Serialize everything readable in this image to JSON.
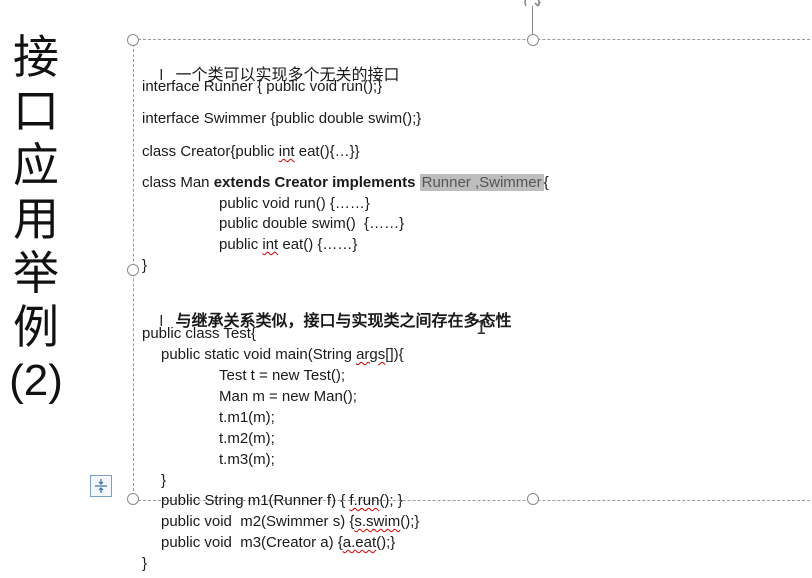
{
  "slide_title_chars": [
    "接",
    "口",
    "应",
    "用",
    "举",
    "例",
    "(2)"
  ],
  "bullet1": "一个类可以实现多个无关的接口",
  "bullet2": "与继承关系类似，接口与实现类之间存在多态性",
  "bullet_marker": "l",
  "code1": {
    "l1": "interface Runner { public void run();}",
    "l2": "interface Swimmer {public double swim();}",
    "l3_a": "class Creator{public ",
    "l3_b": "int",
    "l3_c": " eat(){…}}",
    "l4_a": "class Man ",
    "l4_b": "extends Creator implements",
    "l4_c": " ",
    "l4_sel": "Runner ,Swimmer",
    "l4_d": "{",
    "l5": "public void run() {……}",
    "l6": "public double swim()  {……}",
    "l7_a": "public ",
    "l7_b": "int",
    "l7_c": " eat() {……}",
    "l8": "}"
  },
  "code2": {
    "l1": "public class Test{",
    "l2_a": "public static void main(String ",
    "l2_b": "args",
    "l2_c": "[]){",
    "l3": "Test t = new Test();",
    "l4": "Man m = new Man();",
    "l5": "t.m1(m);",
    "l6": "t.m2(m);",
    "l7": "t.m3(m);",
    "l8": "}",
    "l9_a": "public String m1(Runner f) { ",
    "l9_b": "f.run",
    "l9_c": "(); }",
    "l10_a": "public void  m2(Swimmer s) {",
    "l10_b": "s.swim",
    "l10_c": "();}",
    "l11_a": "public void  m3(Creator a) {",
    "l11_b": "a.eat",
    "l11_c": "();}",
    "l12": "}"
  },
  "colors": {
    "selection": "#bdbdbd",
    "spellcheck": "#d40000",
    "frame": "#9a9a9a"
  },
  "icons": {
    "layout_options": "layout-options-icon",
    "rotate_handle": "rotate-handle-icon",
    "text_cursor": "i-beam-cursor-icon"
  }
}
